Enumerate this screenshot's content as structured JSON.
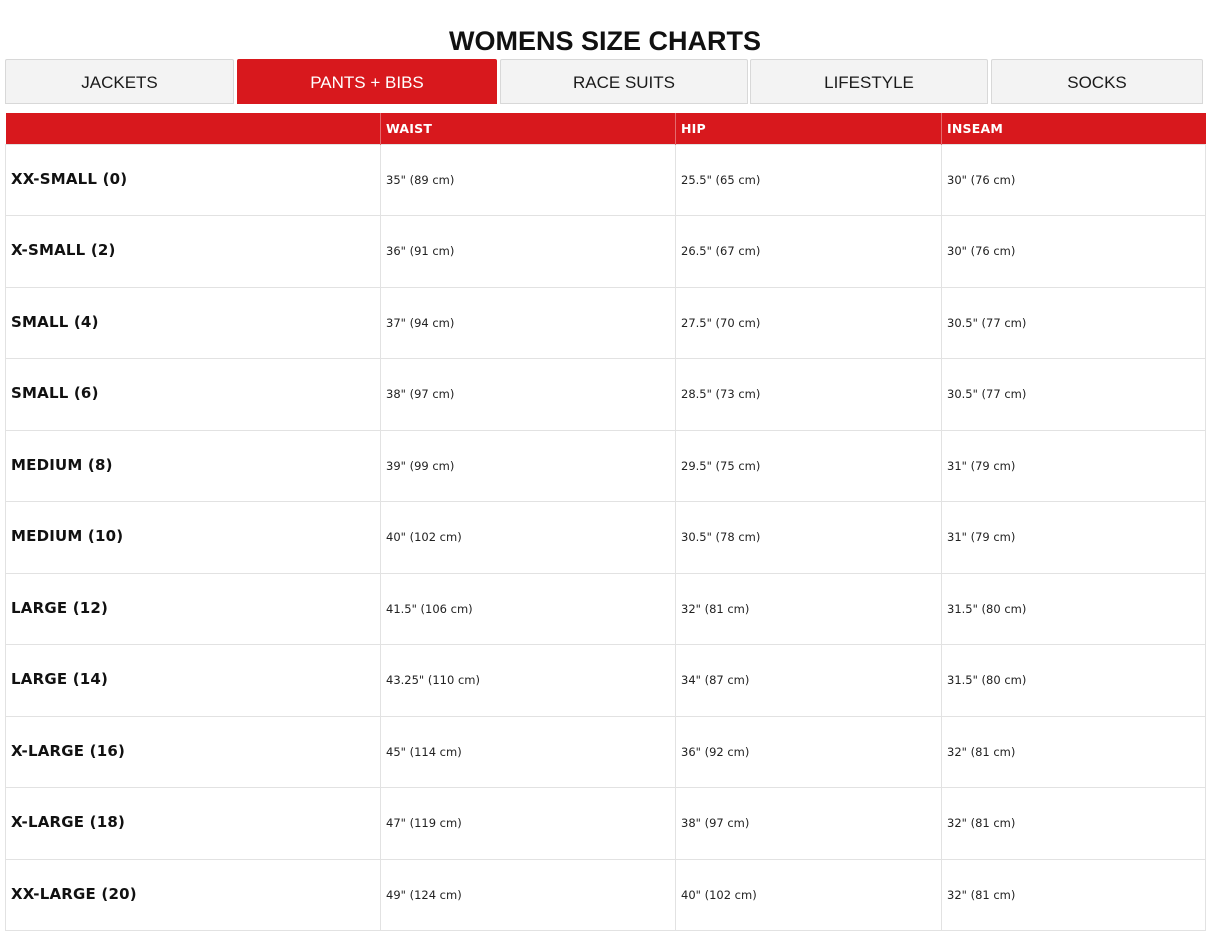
{
  "page": {
    "title": "WOMENS SIZE CHARTS"
  },
  "colors": {
    "accent": "#d8181d",
    "tab_background": "#f3f3f3",
    "border": "#e2e2e2"
  },
  "tabs": [
    {
      "label": "JACKETS",
      "active": false
    },
    {
      "label": "PANTS + BIBS",
      "active": true
    },
    {
      "label": "RACE SUITS",
      "active": false
    },
    {
      "label": "LIFESTYLE",
      "active": false
    },
    {
      "label": "SOCKS",
      "active": false
    }
  ],
  "table": {
    "headers": [
      "",
      "WAIST",
      "HIP",
      "INSEAM"
    ],
    "rows": [
      {
        "size": "XX-SMALL (0)",
        "waist": "35\" (89 cm)",
        "hip": "25.5\" (65 cm)",
        "inseam": "30\" (76 cm)"
      },
      {
        "size": "X-SMALL (2)",
        "waist": "36\" (91 cm)",
        "hip": "26.5\" (67 cm)",
        "inseam": "30\" (76 cm)"
      },
      {
        "size": "SMALL (4)",
        "waist": "37\" (94 cm)",
        "hip": "27.5\" (70 cm)",
        "inseam": "30.5\" (77 cm)"
      },
      {
        "size": "SMALL (6)",
        "waist": "38\" (97 cm)",
        "hip": "28.5\" (73 cm)",
        "inseam": "30.5\" (77 cm)"
      },
      {
        "size": "MEDIUM (8)",
        "waist": "39\" (99 cm)",
        "hip": "29.5\" (75 cm)",
        "inseam": "31\" (79 cm)"
      },
      {
        "size": "MEDIUM (10)",
        "waist": "40\" (102 cm)",
        "hip": "30.5\" (78 cm)",
        "inseam": "31\" (79 cm)"
      },
      {
        "size": "LARGE (12)",
        "waist": "41.5\" (106 cm)",
        "hip": "32\" (81 cm)",
        "inseam": "31.5\" (80 cm)"
      },
      {
        "size": "LARGE (14)",
        "waist": "43.25\" (110 cm)",
        "hip": "34\" (87 cm)",
        "inseam": "31.5\" (80 cm)"
      },
      {
        "size": "X-LARGE (16)",
        "waist": "45\" (114 cm)",
        "hip": "36\" (92 cm)",
        "inseam": "32\" (81 cm)"
      },
      {
        "size": "X-LARGE (18)",
        "waist": "47\" (119 cm)",
        "hip": "38\" (97 cm)",
        "inseam": "32\" (81 cm)"
      },
      {
        "size": "XX-LARGE (20)",
        "waist": "49\" (124 cm)",
        "hip": "40\" (102 cm)",
        "inseam": "32\" (81 cm)"
      }
    ]
  }
}
